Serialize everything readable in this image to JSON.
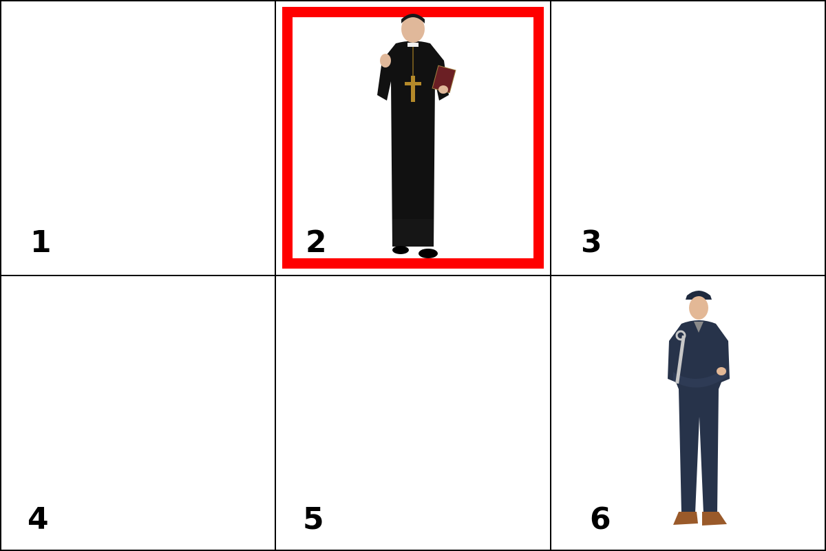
{
  "cells": [
    {
      "number": "1"
    },
    {
      "number": "2",
      "selected": true,
      "content_icon": "priest-icon"
    },
    {
      "number": "3"
    },
    {
      "number": "4"
    },
    {
      "number": "5"
    },
    {
      "number": "6",
      "content_icon": "mechanic-icon"
    }
  ],
  "colors": {
    "selection_border": "#ff0000",
    "grid_line": "#000000",
    "background": "#ffffff"
  }
}
